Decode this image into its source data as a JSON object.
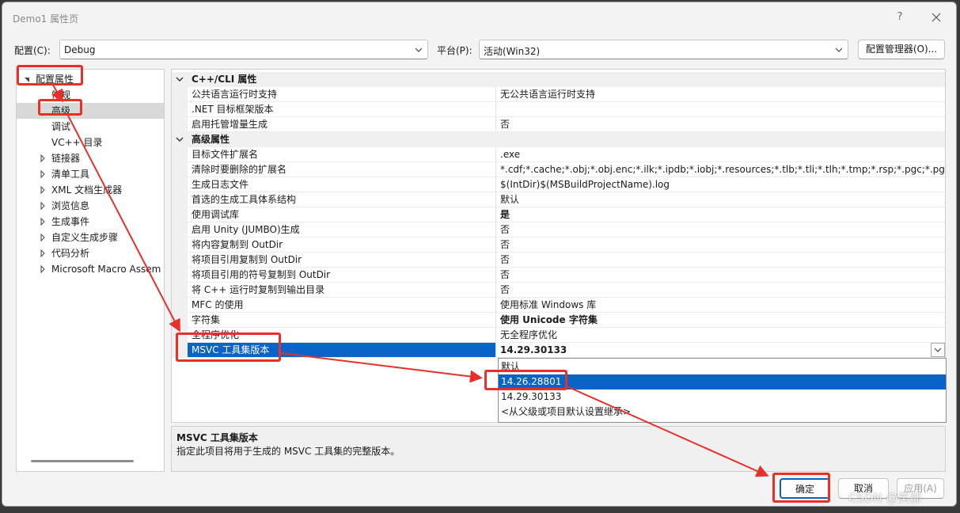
{
  "window": {
    "title": "Demo1 属性页",
    "help": "?",
    "close_icon": "close-icon"
  },
  "toolbar": {
    "config_label": "配置(C):",
    "config_value": "Debug",
    "platform_label": "平台(P):",
    "platform_value": "活动(Win32)",
    "config_manager": "配置管理器(O)..."
  },
  "tree": {
    "items": [
      {
        "label": "配置属性",
        "expanded": true,
        "level": 0
      },
      {
        "label": "常规",
        "level": 1
      },
      {
        "label": "高级",
        "level": 1,
        "selected": true
      },
      {
        "label": "调试",
        "level": 1
      },
      {
        "label": "VC++ 目录",
        "level": 1
      },
      {
        "label": "链接器",
        "level": 1,
        "collapsed": true
      },
      {
        "label": "清单工具",
        "level": 1,
        "collapsed": true
      },
      {
        "label": "XML 文档生成器",
        "level": 1,
        "collapsed": true
      },
      {
        "label": "浏览信息",
        "level": 1,
        "collapsed": true
      },
      {
        "label": "生成事件",
        "level": 1,
        "collapsed": true
      },
      {
        "label": "自定义生成步骤",
        "level": 1,
        "collapsed": true
      },
      {
        "label": "代码分析",
        "level": 1,
        "collapsed": true
      },
      {
        "label": "Microsoft Macro Assem",
        "level": 1,
        "collapsed": true
      }
    ]
  },
  "grid": {
    "categories": [
      {
        "title": "C++/CLI 属性",
        "props": [
          {
            "name": "公共语言运行时支持",
            "value": "无公共语言运行时支持"
          },
          {
            "name": ".NET 目标框架版本",
            "value": ""
          },
          {
            "name": "启用托管增量生成",
            "value": "否"
          }
        ]
      },
      {
        "title": "高级属性",
        "props": [
          {
            "name": "目标文件扩展名",
            "value": ".exe"
          },
          {
            "name": "清除时要删除的扩展名",
            "value": "*.cdf;*.cache;*.obj;*.obj.enc;*.ilk;*.ipdb;*.iobj;*.resources;*.tlb;*.tli;*.tlh;*.tmp;*.rsp;*.pgc;*.pgd;*.meta;"
          },
          {
            "name": "生成日志文件",
            "value": "$(IntDir)$(MSBuildProjectName).log"
          },
          {
            "name": "首选的生成工具体系结构",
            "value": "默认"
          },
          {
            "name": "使用调试库",
            "value": "是",
            "bold": true
          },
          {
            "name": "启用 Unity (JUMBO)生成",
            "value": "否"
          },
          {
            "name": "将内容复制到 OutDir",
            "value": "否"
          },
          {
            "name": "将项目引用复制到 OutDir",
            "value": "否"
          },
          {
            "name": "将项目引用的符号复制到 OutDir",
            "value": "否"
          },
          {
            "name": "将 C++ 运行时复制到输出目录",
            "value": "否"
          },
          {
            "name": "MFC 的使用",
            "value": "使用标准 Windows 库"
          },
          {
            "name": "字符集",
            "value": "使用 Unicode 字符集",
            "bold": true
          },
          {
            "name": "全程序优化",
            "value": "无全程序优化"
          },
          {
            "name": "MSVC 工具集版本",
            "value": "14.29.30133",
            "selected": true
          }
        ]
      }
    ],
    "dropdown_icon": "chevron-down-icon"
  },
  "dropdown": {
    "options": [
      "默认",
      "14.26.28801",
      "14.29.30133",
      "<从父级或项目默认设置继承>"
    ],
    "highlighted_index": 1
  },
  "description": {
    "title": "MSVC 工具集版本",
    "text": "指定此项目将用于生成的 MSVC 工具集的完整版本。"
  },
  "buttons": {
    "ok": "确定",
    "cancel": "取消",
    "apply": "应用(A)"
  },
  "annotation_color": "#e8302a",
  "selection_color": "#0a64c8",
  "watermark": "CSDN @笑郝"
}
